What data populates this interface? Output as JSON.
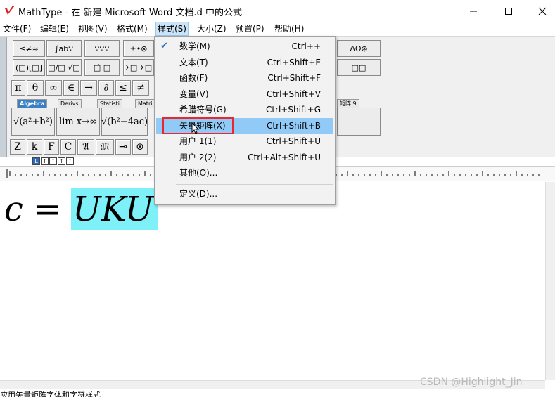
{
  "window": {
    "title": "MathType - 在 新建 Microsoft Word 文档.d 中的公式",
    "controls": [
      "minimize",
      "maximize",
      "close"
    ]
  },
  "menubar": {
    "items": [
      {
        "label": "文件(F)"
      },
      {
        "label": "编辑(E)"
      },
      {
        "label": "视图(V)"
      },
      {
        "label": "格式(M)"
      },
      {
        "label": "样式(S)",
        "active": true
      },
      {
        "label": "大小(Z)"
      },
      {
        "label": "预置(P)"
      },
      {
        "label": "帮助(H)"
      }
    ]
  },
  "toolbar": {
    "row1": [
      "≤≠≈",
      "∫ab∵",
      "∵∵∵",
      "±•⊗",
      "ΛΩ⊛"
    ],
    "row2": [
      "(□)[□]",
      "□/□ √□",
      "□̂ □̄",
      "Σ□ Σ□",
      "□□"
    ],
    "row3": [
      "π",
      "θ",
      "∞",
      "∈",
      "→",
      "∂",
      "≤",
      "≠"
    ],
    "tabs": [
      "Algebra",
      "Derivs",
      "Statisti",
      "Matri",
      "矩阵 9"
    ],
    "active_tab": "Algebra",
    "big": [
      "√(a²+b²)",
      "lim x→∞",
      "√(b²−4ac)"
    ],
    "row4": [
      "Z",
      "k",
      "F",
      "C",
      "𝔄",
      "𝔐",
      "⊸",
      "⊗"
    ],
    "ruler_tabs": [
      "L",
      "↑",
      "↑",
      "↑",
      "↑"
    ]
  },
  "formula": {
    "lhs": "c",
    "eq": "=",
    "selected": "UKU"
  },
  "style_menu": {
    "items": [
      {
        "label": "数学(M)",
        "shortcut": "Ctrl++",
        "checked": true
      },
      {
        "label": "文本(T)",
        "shortcut": "Ctrl+Shift+E"
      },
      {
        "label": "函数(F)",
        "shortcut": "Ctrl+Shift+F"
      },
      {
        "label": "变量(V)",
        "shortcut": "Ctrl+Shift+V"
      },
      {
        "label": "希腊符号(G)",
        "shortcut": "Ctrl+Shift+G"
      },
      {
        "label": "矢量矩阵(X)",
        "shortcut": "Ctrl+Shift+B",
        "hover": true
      },
      {
        "label": "用户 1(1)",
        "shortcut": "Ctrl+Shift+U"
      },
      {
        "label": "用户 2(2)",
        "shortcut": "Ctrl+Alt+Shift+U"
      },
      {
        "label": "其他(O)...",
        "shortcut": ""
      },
      {
        "label": "定义(D)...",
        "shortcut": ""
      }
    ]
  },
  "status": "应用矢量矩阵字体和字符样式",
  "watermark": "CSDN @Highlight_Jin",
  "colors": {
    "selection": "#7df0f8",
    "menu_hover": "#91c9f7",
    "annotation_box": "#e8282e",
    "active_tab": "#3b7fc4"
  }
}
